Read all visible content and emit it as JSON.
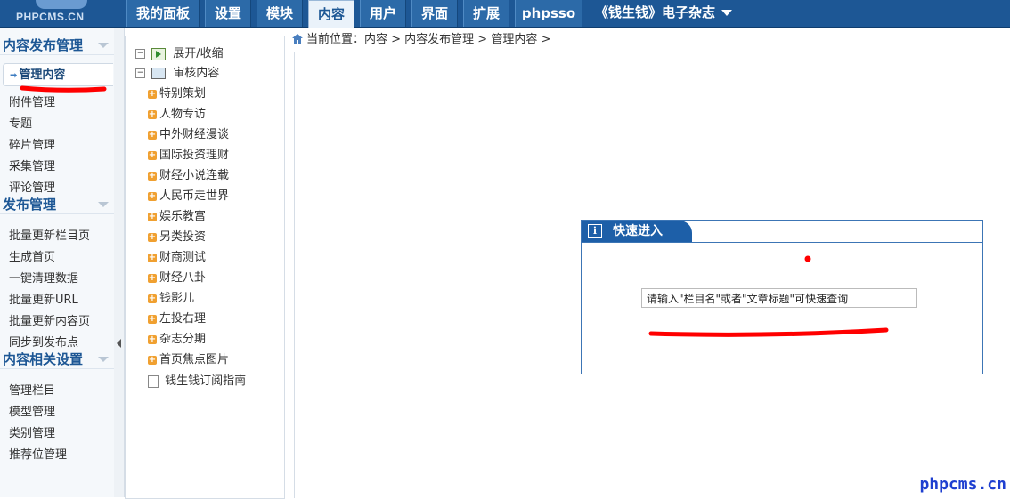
{
  "logo": {
    "text": "PHPCMS.CN"
  },
  "nav": {
    "items": [
      "我的面板",
      "设置",
      "模块",
      "内容",
      "用户",
      "界面",
      "扩展",
      "phpsso"
    ],
    "site": "《钱生钱》电子杂志"
  },
  "sidebar": {
    "sections": [
      {
        "title": "内容发布管理",
        "items": [
          "管理内容",
          "附件管理",
          "专题",
          "碎片管理",
          "采集管理",
          "评论管理"
        ]
      },
      {
        "title": "发布管理",
        "items": [
          "批量更新栏目页",
          "生成首页",
          "一键清理数据",
          "批量更新URL",
          "批量更新内容页",
          "同步到发布点"
        ]
      },
      {
        "title": "内容相关设置",
        "items": [
          "管理栏目",
          "模型管理",
          "类别管理",
          "推荐位管理"
        ]
      }
    ]
  },
  "tree": {
    "expand_label": "展开/收缩",
    "root": "审核内容",
    "nodes": [
      "特别策划",
      "人物专访",
      "中外财经漫谈",
      "国际投资理财",
      "财经小说连载",
      "人民币走世界",
      "娱乐教富",
      "另类投资",
      "财商测试",
      "财经八卦",
      "钱影儿",
      "左投右理",
      "杂志分期",
      "首页焦点图片"
    ],
    "last": "钱生钱订阅指南"
  },
  "breadcrumb": {
    "text": "当前位置：内容 > 内容发布管理 > 管理内容 >"
  },
  "quick": {
    "title": "快速进入",
    "input_value": "请输入\"栏目名\"或者\"文章标题\"可快速查询"
  },
  "watermark": "phpcms.cn",
  "colors": {
    "accent": "#1d5795",
    "annotation": "#ff0000"
  }
}
